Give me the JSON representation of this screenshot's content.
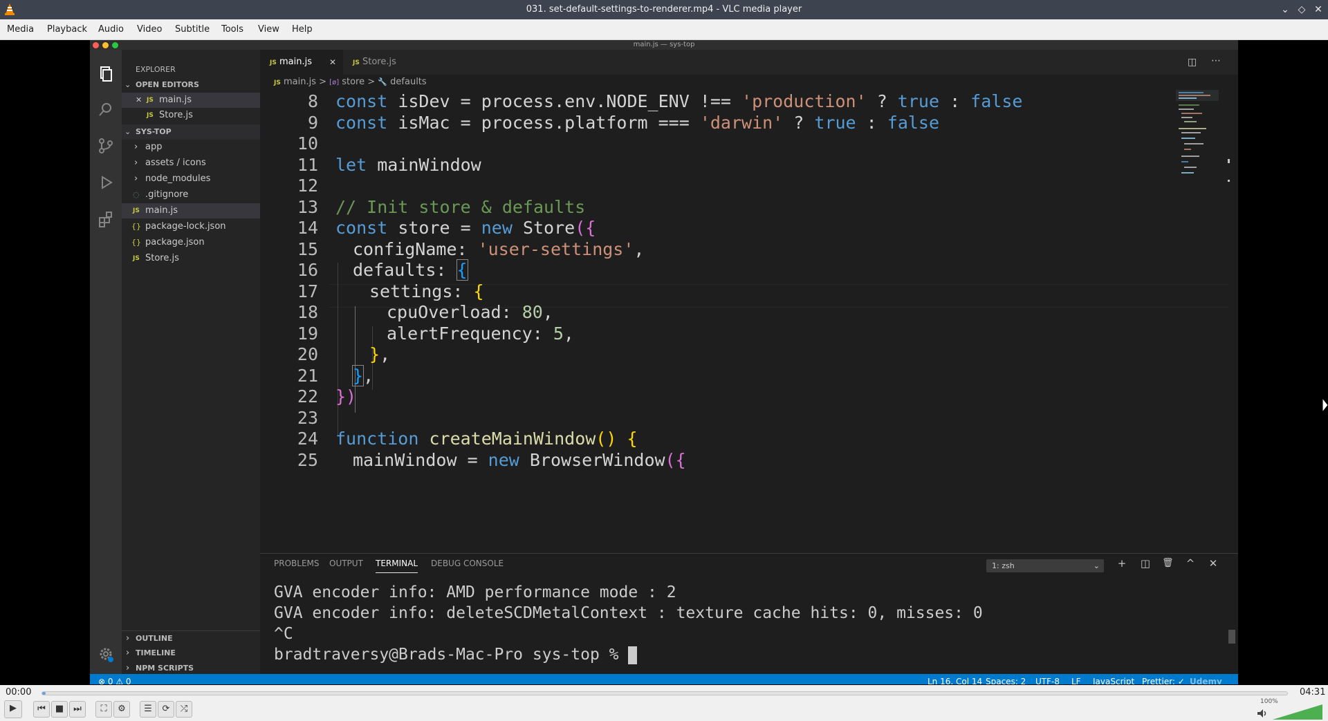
{
  "window": {
    "title": "031. set-default-settings-to-renderer.mp4 - VLC media player",
    "controls": {
      "minimize": "⌄",
      "restore": "◇",
      "close": "✕"
    }
  },
  "menu": [
    "Media",
    "Playback",
    "Audio",
    "Video",
    "Subtitle",
    "Tools",
    "View",
    "Help"
  ],
  "vscode": {
    "window_title": "main.js — sys-top",
    "sidebar": {
      "explorer_title": "EXPLORER",
      "open_editors_header": "OPEN EDITORS",
      "open_editors": [
        {
          "name": "main.js",
          "close_icon": "✕"
        },
        {
          "name": "Store.js"
        }
      ],
      "project_header": "SYS-TOP",
      "items": [
        {
          "name": "app",
          "type": "folder",
          "chevron": "›"
        },
        {
          "name": "assets / icons",
          "type": "folder",
          "chevron": "›"
        },
        {
          "name": "node_modules",
          "type": "folder",
          "chevron": "›"
        },
        {
          "name": ".gitignore",
          "type": "file",
          "icon": "◌"
        },
        {
          "name": "main.js",
          "type": "js",
          "icon": "JS"
        },
        {
          "name": "package-lock.json",
          "type": "json",
          "icon": "{}"
        },
        {
          "name": "package.json",
          "type": "json",
          "icon": "{}"
        },
        {
          "name": "Store.js",
          "type": "js",
          "icon": "JS"
        }
      ],
      "bottom_sections": [
        "OUTLINE",
        "TIMELINE",
        "NPM SCRIPTS"
      ]
    },
    "tabs": [
      {
        "label": "main.js",
        "icon": "JS",
        "active": true,
        "close": "✕"
      },
      {
        "label": "Store.js",
        "icon": "JS",
        "active": false
      }
    ],
    "breadcrumbs": {
      "file": "main.js",
      "sep": ">",
      "symbol1": "store",
      "symbol2": "defaults"
    },
    "line_numbers": [
      "8",
      "9",
      "10",
      "11",
      "12",
      "13",
      "14",
      "15",
      "16",
      "17",
      "18",
      "19",
      "20",
      "21",
      "22",
      "23",
      "24",
      "25"
    ],
    "code": {
      "l8": {
        "kw": "const",
        "name": " isDev = process.env.NODE_ENV !== ",
        "str": "'production'",
        "rest": " ? ",
        "t": "true",
        "c": " : ",
        "f": "false"
      },
      "l9": {
        "kw": "const",
        "name": " isMac = process.platform === ",
        "str": "'darwin'",
        "rest": " ? ",
        "t": "true",
        "c": " : ",
        "f": "false"
      },
      "l11": {
        "kw": "let",
        "name": " mainWindow"
      },
      "l13": {
        "comment": "// Init store & defaults"
      },
      "l14": {
        "kw": "const",
        "name": " store = ",
        "new": "new",
        "cls": " Store",
        "open": "({"
      },
      "l15": {
        "prop": "configName",
        "colon": ": ",
        "str": "'user-settings'",
        "end": ","
      },
      "l16": {
        "prop": "defaults",
        "colon": ": ",
        "open": "{"
      },
      "l17": {
        "prop": "settings",
        "colon": ": ",
        "open": "{"
      },
      "l18": {
        "prop": "cpuOverload",
        "colon": ": ",
        "num": "80",
        "end": ","
      },
      "l19": {
        "prop": "alertFrequency",
        "colon": ": ",
        "num": "5",
        "end": ","
      },
      "l20": {
        "close": "}",
        "end": ","
      },
      "l21": {
        "close": "}",
        "end": ","
      },
      "l22": {
        "close": "})"
      },
      "l24": {
        "kw": "function",
        "fn": " createMainWindow",
        "paren": "()",
        "open": " {"
      },
      "l25": {
        "name": "mainWindow = ",
        "new": "new",
        "cls": " BrowserWindow",
        "open": "({"
      }
    },
    "panel": {
      "tabs": [
        "PROBLEMS",
        "OUTPUT",
        "TERMINAL",
        "DEBUG CONSOLE"
      ],
      "active_tab": "TERMINAL",
      "shell_select": "1: zsh",
      "lines": [
        "GVA encoder info: AMD performance mode : 2",
        "GVA encoder info: deleteSCDMetalContext : texture cache hits: 0, misses: 0",
        "^C",
        "bradtraversy@Brads-Mac-Pro sys-top % "
      ],
      "icons": {
        "add": "+",
        "split": "◫",
        "trash": "🗑",
        "maximize": "^",
        "close": "✕"
      }
    },
    "statusbar": {
      "errors": "⊗ 0 ⚠ 0",
      "position": "Ln 16, Col 14",
      "spaces": "Spaces: 2",
      "encoding": "UTF-8",
      "eol": "LF",
      "language": "JavaScript",
      "formatter": "Prettier: ✓",
      "watermark": "Udemy"
    }
  },
  "player": {
    "elapsed": "00:00",
    "total": "04:31",
    "progress": 0.003,
    "volume_label": "100%",
    "volume_level": 1.0,
    "buttons": {
      "play": "▶",
      "prev": "⏮",
      "stop": "■",
      "next": "⏭",
      "fullscreen": "⛶",
      "extended": "⚙",
      "playlist": "☰",
      "loop": "⟳",
      "shuffle": "⤮"
    }
  },
  "colors": {
    "vlc_titlebar": "#3d4450",
    "vscode_status": "#007acc",
    "seek_fill": "#6aa0e2",
    "volume": "#4caf50"
  }
}
